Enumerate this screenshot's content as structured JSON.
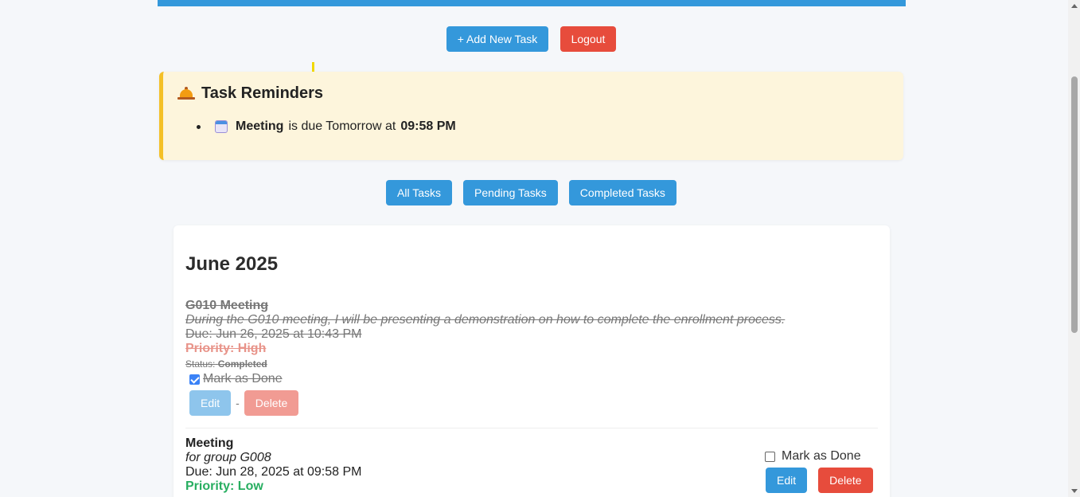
{
  "top_actions": {
    "add_task_label": "+ Add New Task",
    "logout_label": "Logout"
  },
  "reminders": {
    "title": "Task Reminders",
    "title_icon": "bell-icon",
    "items": [
      {
        "icon": "calendar-icon",
        "task_name": "Meeting",
        "middle_text": "is due Tomorrow at",
        "time": "09:58 PM"
      }
    ]
  },
  "filters": {
    "all_label": "All Tasks",
    "pending_label": "Pending Tasks",
    "completed_label": "Completed Tasks"
  },
  "month_group": {
    "title": "June 2025",
    "tasks": [
      {
        "title": "G010 Meeting",
        "description": "During the G010 meeting, I will be presenting a demonstration on how to complete the enrollment process.",
        "due": "Due: Jun 26, 2025 at 10:43 PM",
        "priority": "Priority: High",
        "status_label": "Status:",
        "status_value": "Completed",
        "mark_done_label": "Mark as Done",
        "done": true,
        "edit_label": "Edit",
        "separator": "-",
        "delete_label": "Delete"
      },
      {
        "title": "Meeting",
        "description": "for group G008",
        "due": "Due: Jun 28, 2025 at 09:58 PM",
        "priority": "Priority: Low",
        "mark_done_label": "Mark as Done",
        "done": false,
        "edit_label": "Edit",
        "delete_label": "Delete"
      }
    ]
  },
  "colors": {
    "primary": "#3498db",
    "danger": "#e74c3c",
    "reminder_bg": "#fdf5dc",
    "reminder_accent": "#f4c026",
    "priority_high": "#e8948a",
    "priority_low": "#27ae60"
  }
}
